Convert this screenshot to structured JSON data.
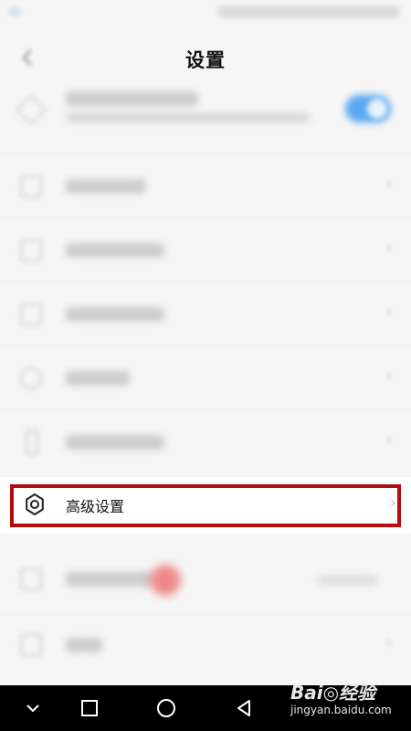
{
  "header": {
    "title": "设置"
  },
  "advanced_settings": {
    "label": "高级设置",
    "icon": "gear-icon",
    "chevron": "›"
  },
  "highlight_color": "#b50d0d",
  "watermark": {
    "brand": "Bai◎经验",
    "domain": "jingyan.baidu.com"
  },
  "nav": {
    "icons": [
      "collapse-chevron-icon",
      "recents-square-icon",
      "home-circle-icon",
      "back-triangle-icon"
    ]
  }
}
